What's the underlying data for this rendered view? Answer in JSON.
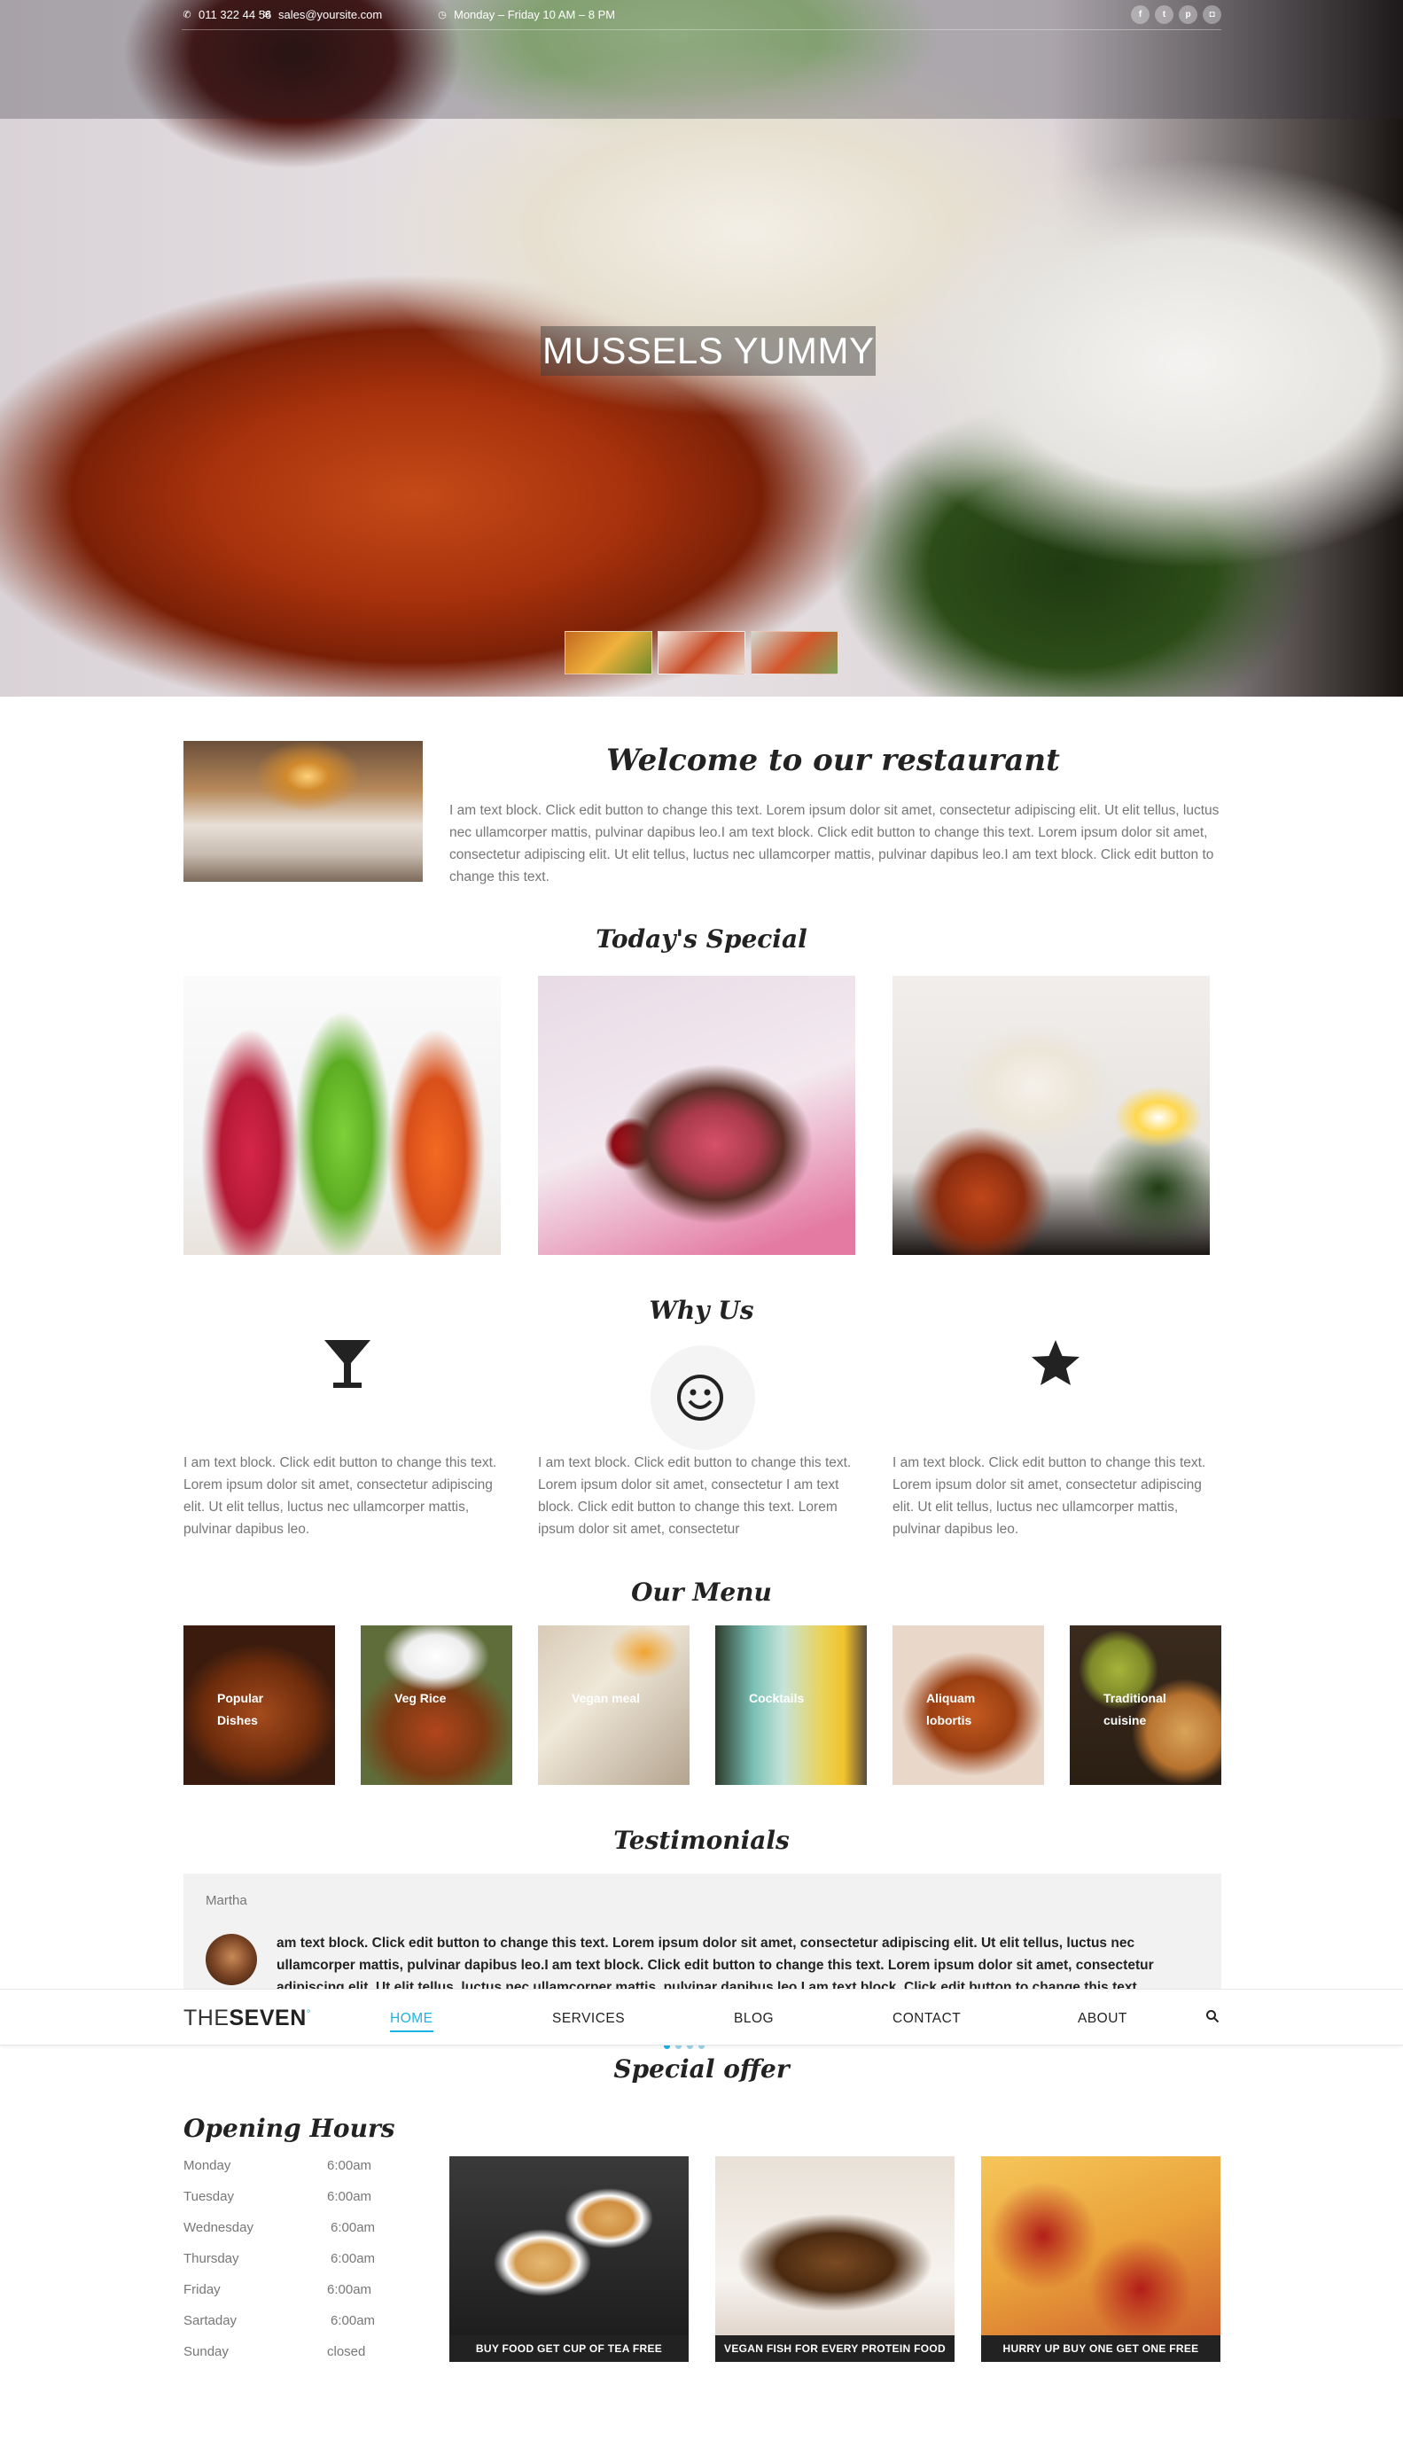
{
  "topbar": {
    "phone": "011 322 44 56",
    "email": "sales@yoursite.com",
    "hours": "Monday – Friday 10 AM – 8 PM",
    "social": [
      {
        "icon": "facebook-icon",
        "glyph": "f"
      },
      {
        "icon": "twitter-icon",
        "glyph": "t"
      },
      {
        "icon": "pinterest-icon",
        "glyph": "p"
      },
      {
        "icon": "instagram-icon",
        "glyph": "◘"
      }
    ]
  },
  "hero": {
    "title": "MUSSELS YUMMY"
  },
  "welcome": {
    "title": "Welcome to our restaurant",
    "text": "I am text block. Click edit button to change this text. Lorem ipsum dolor sit amet, consectetur adipiscing elit. Ut elit tellus, luctus nec ullamcorper mattis, pulvinar dapibus leo.I am text block. Click edit button to change this text. Lorem ipsum dolor sit amet, consectetur adipiscing elit. Ut elit tellus, luctus nec ullamcorper mattis, pulvinar dapibus leo.I am text block. Click edit button to change this text."
  },
  "special": {
    "title": "Today's Special"
  },
  "why": {
    "title": "Why Us",
    "items": [
      {
        "icon": "cocktail-glass-icon",
        "glyph": "🍸",
        "text": "I am text block. Click edit button to change this text. Lorem ipsum dolor sit amet, consectetur adipiscing elit. Ut elit tellus, luctus nec ullamcorper mattis, pulvinar dapibus leo."
      },
      {
        "icon": "smiley-icon",
        "glyph": "☺",
        "text": "I am text block. Click edit button to change this text. Lorem ipsum dolor sit amet, consectetur I am text block. Click edit button to change this text. Lorem ipsum dolor sit amet, consectetur"
      },
      {
        "icon": "star-icon",
        "glyph": "★",
        "text": "I am text block. Click edit button to change this text. Lorem ipsum dolor sit amet, consectetur adipiscing elit. Ut elit tellus, luctus nec ullamcorper mattis, pulvinar dapibus leo."
      }
    ]
  },
  "menu": {
    "title": "Our Menu",
    "items": [
      "Popular Dishes",
      "Veg Rice",
      "Vegan meal",
      "Cocktails",
      "Aliquam lobortis",
      "Traditional cuisine"
    ]
  },
  "testimonials": {
    "title": "Testimonials",
    "name": "Martha",
    "text": "am text block. Click edit button to change this text. Lorem ipsum dolor sit amet, consectetur adipiscing elit. Ut elit tellus, luctus nec ullamcorper mattis, pulvinar dapibus leo.I am text block. Click edit button to change this text. Lorem ipsum dolor sit amet, consectetur adipiscing elit. Ut elit tellus, luctus nec ullamcorper mattis, pulvinar dapibus leo.I am text block. Click edit button to change this text."
  },
  "nav": {
    "logo_light": "THE",
    "logo_bold": "SEVEN",
    "logo_mark": "°",
    "items": [
      "HOME",
      "SERVICES",
      "BLOG",
      "CONTACT",
      "ABOUT"
    ],
    "active": "HOME"
  },
  "offer": {
    "title": "Special offer",
    "items": [
      "BUY FOOD GET CUP OF TEA FREE",
      "VEGAN FISH FOR EVERY PROTEIN FOOD",
      "HURRY UP BUY ONE GET ONE FREE"
    ]
  },
  "hours": {
    "title": "Opening Hours",
    "rows": [
      {
        "day": "Monday",
        "time": "6:00am"
      },
      {
        "day": "Tuesday",
        "time": "6:00am"
      },
      {
        "day": "Wednesday",
        "time": "6:00am"
      },
      {
        "day": "Thursday",
        "time": "6:00am"
      },
      {
        "day": "Friday",
        "time": "6:00am"
      },
      {
        "day": "Sartaday",
        "time": "6:00am"
      },
      {
        "day": "Sunday",
        "time": "closed"
      }
    ]
  }
}
